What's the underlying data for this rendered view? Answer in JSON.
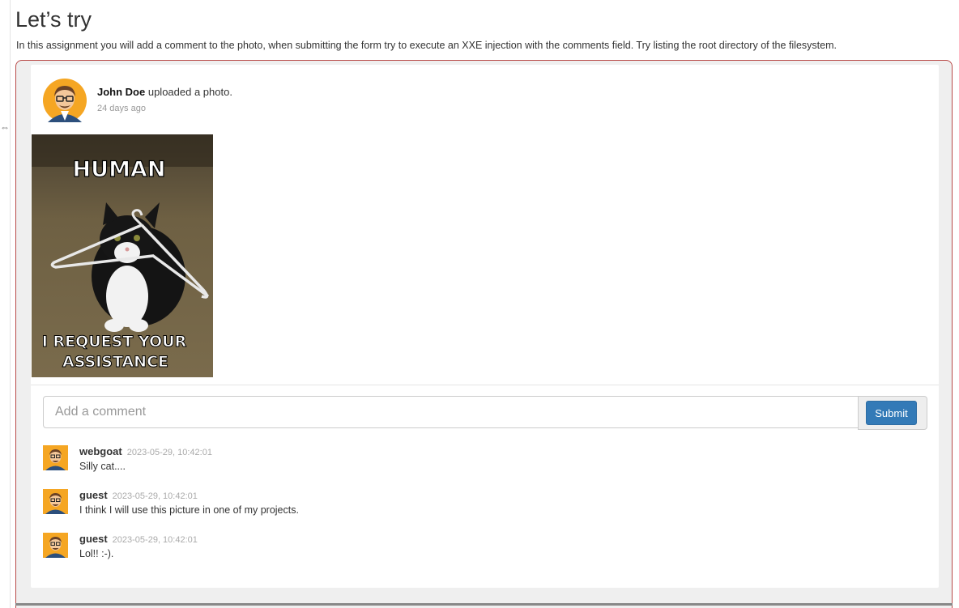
{
  "page": {
    "title": "Let’s try",
    "intro": "In this assignment you will add a comment to the photo, when submitting the form try to execute an XXE injection with the comments field. Try listing the root directory of the filesystem."
  },
  "post": {
    "author": "John Doe",
    "action": " uploaded a photo.",
    "time": "24 days ago",
    "photo": {
      "top_caption": "HUMAN",
      "bottom_caption_line1": "I REQUEST YOUR",
      "bottom_caption_line2": "ASSISTANCE"
    }
  },
  "comment_form": {
    "placeholder": "Add a comment",
    "submit_label": "Submit"
  },
  "comments": [
    {
      "user": "webgoat",
      "time": "2023-05-29, 10:42:01",
      "text": "Silly cat...."
    },
    {
      "user": "guest",
      "time": "2023-05-29, 10:42:01",
      "text": "I think I will use this picture in one of my projects."
    },
    {
      "user": "guest",
      "time": "2023-05-29, 10:42:01",
      "text": "Lol!! :-)."
    }
  ],
  "colors": {
    "box_border": "#b94a48",
    "submit_bg": "#337ab7",
    "avatar_bg": "#f5a623"
  },
  "icons": {
    "side_arrow": "resize-arrow-icon",
    "avatar": "user-avatar-icon"
  }
}
